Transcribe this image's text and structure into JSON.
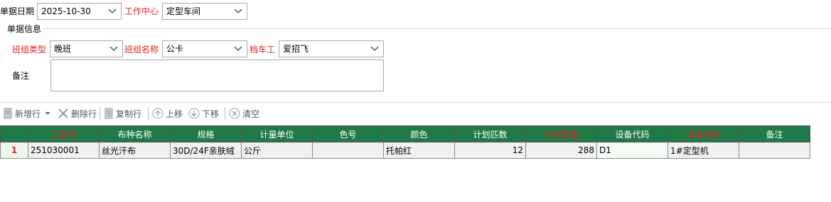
{
  "header": {
    "date_label": "单据日期",
    "date_value": "2025-10-30",
    "workcenter_label": "工作中心",
    "workcenter_value": "定型车间"
  },
  "doc_info": {
    "section_title": "单据信息",
    "shift_type_label": "班组类型",
    "shift_type_value": "晚班",
    "shift_name_label": "班组名称",
    "shift_name_value": "公卡",
    "operator_label": "档车工",
    "operator_value": "爱招飞",
    "remark_label": "备注",
    "remark_value": ""
  },
  "toolbar": {
    "add_row": "新增行",
    "delete_row": "删除行",
    "copy_row": "复制行",
    "move_up": "上移",
    "move_down": "下移",
    "clear": "清空"
  },
  "grid": {
    "columns": [
      "工单号",
      "布种名称",
      "规格",
      "计量单位",
      "色号",
      "颜色",
      "计划匹数",
      "计划数量",
      "设备代码",
      "设备名称",
      "备注"
    ],
    "required_columns": [
      0,
      7,
      9
    ],
    "rows": [
      {
        "row_no": "1",
        "cells": [
          "251030001",
          "丝光汗布",
          "30D/24F亲肤绒",
          "公斤",
          "",
          "托帕红",
          "12",
          "288",
          "D1",
          "1#定型机",
          ""
        ]
      }
    ]
  },
  "colors": {
    "header_green": "#1f7a47",
    "required_red": "#e0241f"
  }
}
